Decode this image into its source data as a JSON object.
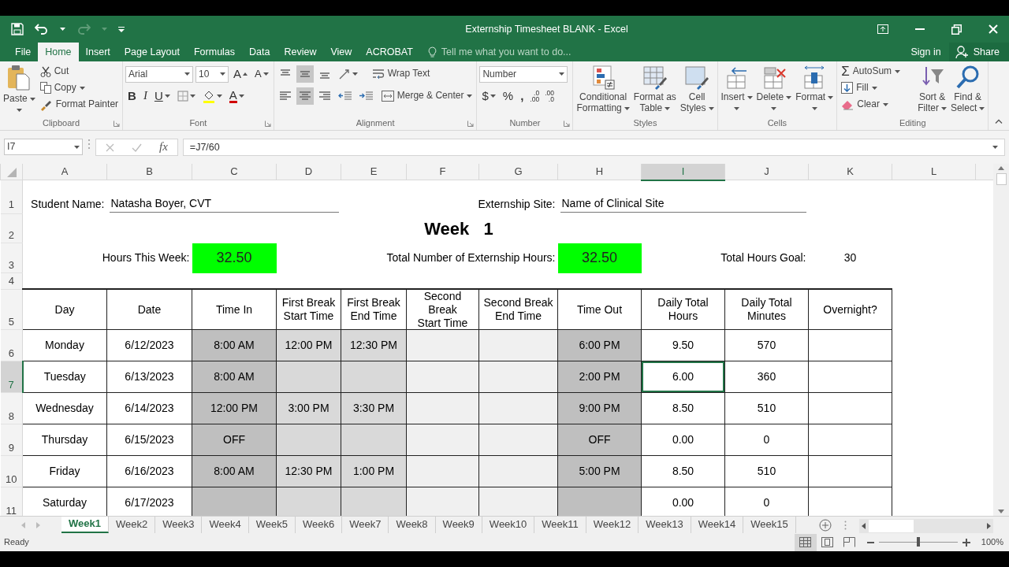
{
  "window": {
    "title": "Externship Timesheet BLANK - Excel"
  },
  "ribbon_tabs": [
    {
      "label": "File",
      "selected": false
    },
    {
      "label": "Home",
      "selected": true
    },
    {
      "label": "Insert",
      "selected": false
    },
    {
      "label": "Page Layout",
      "selected": false
    },
    {
      "label": "Formulas",
      "selected": false
    },
    {
      "label": "Data",
      "selected": false
    },
    {
      "label": "Review",
      "selected": false
    },
    {
      "label": "View",
      "selected": false
    },
    {
      "label": "ACROBAT",
      "selected": false
    }
  ],
  "tell_me": {
    "placeholder": "Tell me what you want to do..."
  },
  "account": {
    "sign_in": "Sign in",
    "share": "Share"
  },
  "ribbon_groups": [
    {
      "kind": "clipboard",
      "label": "Clipboard",
      "paste": "Paste",
      "cut": "Cut",
      "copy": "Copy",
      "format_painter": "Format Painter"
    },
    {
      "kind": "font",
      "label": "Font",
      "font_name": "Arial",
      "font_size": "10",
      "grow": "A",
      "shrink": "A",
      "bold": "B",
      "italic": "I",
      "underline": "U",
      "font_color": "A"
    },
    {
      "kind": "alignment",
      "label": "Alignment",
      "vertical_align": [
        {
          "selected": false
        },
        {
          "selected": true
        },
        {
          "selected": false
        }
      ],
      "horizontal_align": [
        {
          "selected": false
        },
        {
          "selected": true
        },
        {
          "selected": false
        }
      ],
      "wrap_text": "Wrap Text",
      "merge_center": "Merge & Center"
    },
    {
      "kind": "number",
      "label": "Number",
      "format": "Number",
      "currency": "$",
      "percent": "%",
      "comma": ",",
      "increase_decimal": [
        ".0",
        ".00"
      ],
      "decrease_decimal": [
        ".00",
        ".0"
      ]
    },
    {
      "kind": "styles",
      "label": "Styles",
      "buttons": [
        [
          "Conditional",
          "Formatting"
        ],
        [
          "Format as",
          "Table"
        ],
        [
          "Cell",
          "Styles"
        ]
      ]
    },
    {
      "kind": "cells",
      "label": "Cells",
      "buttons": [
        [
          "Insert"
        ],
        [
          "Delete"
        ],
        [
          "Format"
        ]
      ]
    },
    {
      "kind": "editing",
      "label": "Editing",
      "sigma": "Σ",
      "autosum": "AutoSum",
      "fill": "Fill",
      "clear": "Clear",
      "buttons": [
        [
          "Sort &",
          "Filter"
        ],
        [
          "Find &",
          "Select"
        ]
      ]
    }
  ],
  "formula_bar": {
    "name_box": "I7",
    "fx": "fx",
    "formula": "=J7/60"
  },
  "columns": [
    {
      "label": "A",
      "selected": false
    },
    {
      "label": "B",
      "selected": false
    },
    {
      "label": "C",
      "selected": false
    },
    {
      "label": "D",
      "selected": false
    },
    {
      "label": "E",
      "selected": false
    },
    {
      "label": "F",
      "selected": false
    },
    {
      "label": "G",
      "selected": false
    },
    {
      "label": "H",
      "selected": false
    },
    {
      "label": "I",
      "selected": true
    },
    {
      "label": "J",
      "selected": false
    },
    {
      "label": "K",
      "selected": false
    },
    {
      "label": "L",
      "selected": false
    }
  ],
  "row_headers": [
    {
      "label": "1",
      "selected": false
    },
    {
      "label": "2",
      "selected": false
    },
    {
      "label": "3",
      "selected": false
    },
    {
      "label": "4",
      "selected": false
    },
    {
      "label": "5",
      "selected": false
    },
    {
      "label": "6",
      "selected": false
    },
    {
      "label": "7",
      "selected": true
    },
    {
      "label": "8",
      "selected": false
    },
    {
      "label": "9",
      "selected": false
    },
    {
      "label": "10",
      "selected": false
    },
    {
      "label": "11",
      "selected": false
    }
  ],
  "sheet": {
    "student_label": "Student Name:",
    "student_name": "Natasha Boyer, CVT",
    "site_label": "Externship Site:",
    "site_name": "Name of Clinical Site",
    "week_title": "Week   1",
    "hours_label": "Hours This Week:",
    "hours_value": "32.50",
    "total_label": "Total Number of Externship Hours:",
    "total_value": "32.50",
    "goal_label": "Total Hours Goal:",
    "goal_value": "30"
  },
  "table": {
    "columns": [
      "Day",
      "Date",
      "Time In",
      "First Break\nStart Time",
      "First Break\nEnd Time",
      "Second Break\nStart Time",
      "Second Break\nEnd Time",
      "Time Out",
      "Daily Total\nHours",
      "Daily Total\nMinutes",
      "Overnight?"
    ],
    "rows": [
      [
        "Monday",
        "6/12/2023",
        "8:00 AM",
        "12:00 PM",
        "12:30 PM",
        null,
        null,
        "6:00 PM",
        "9.50",
        "570",
        null
      ],
      [
        "Tuesday",
        "6/13/2023",
        "8:00 AM",
        null,
        null,
        null,
        null,
        "2:00 PM",
        "6.00",
        "360",
        null
      ],
      [
        "Wednesday",
        "6/14/2023",
        "12:00 PM",
        "3:00 PM",
        "3:30 PM",
        null,
        null,
        "9:00 PM",
        "8.50",
        "510",
        null
      ],
      [
        "Thursday",
        "6/15/2023",
        "OFF",
        null,
        null,
        null,
        null,
        "OFF",
        "0.00",
        "0",
        null
      ],
      [
        "Friday",
        "6/16/2023",
        "8:00 AM",
        "12:30 PM",
        "1:00 PM",
        null,
        null,
        "5:00 PM",
        "8.50",
        "510",
        null
      ],
      [
        "Saturday",
        "6/17/2023",
        null,
        null,
        null,
        null,
        null,
        null,
        "0.00",
        "0",
        null
      ]
    ]
  },
  "sheet_tabs": [
    {
      "label": "Week1",
      "selected": true
    },
    {
      "label": "Week2",
      "selected": false
    },
    {
      "label": "Week3",
      "selected": false
    },
    {
      "label": "Week4",
      "selected": false
    },
    {
      "label": "Week5",
      "selected": false
    },
    {
      "label": "Week6",
      "selected": false
    },
    {
      "label": "Week7",
      "selected": false
    },
    {
      "label": "Week8",
      "selected": false
    },
    {
      "label": "Week9",
      "selected": false
    },
    {
      "label": "Week10",
      "selected": false
    },
    {
      "label": "Week11",
      "selected": false
    },
    {
      "label": "Week12",
      "selected": false
    },
    {
      "label": "Week13",
      "selected": false
    },
    {
      "label": "Week14",
      "selected": false
    },
    {
      "label": "Week15",
      "selected": false
    }
  ],
  "status_bar": {
    "status": "Ready",
    "views": [
      {
        "selected": true
      },
      {
        "selected": false
      },
      {
        "selected": false
      }
    ],
    "zoom_slider": {
      "level": 0.5
    },
    "zoom": "100%"
  }
}
